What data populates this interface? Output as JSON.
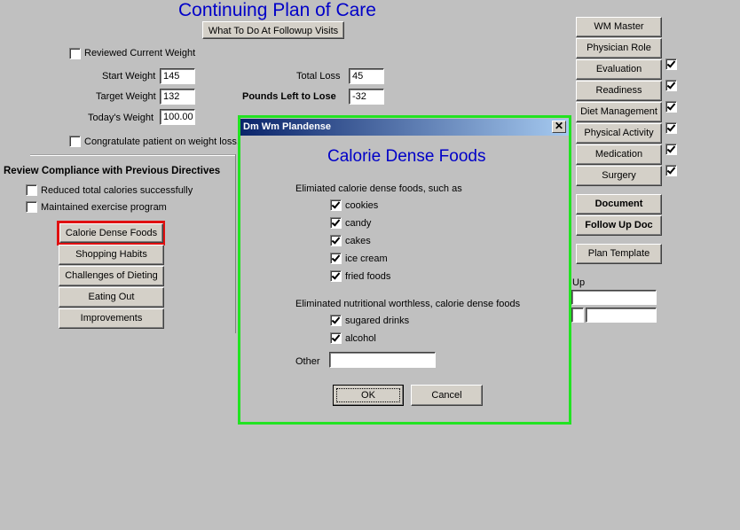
{
  "page": {
    "title": "Continuing Plan of Care",
    "followup_button": "What To Do At Followup Visits",
    "reviewed_weight": {
      "label": "Reviewed Current Weight",
      "checked": false
    },
    "weights": {
      "start_label": "Start Weight",
      "start_value": "145",
      "target_label": "Target Weight",
      "target_value": "132",
      "today_label": "Today's Weight",
      "today_value": "100.00",
      "total_loss_label": "Total Loss",
      "total_loss_value": "45",
      "pounds_left_label": "Pounds Left to Lose",
      "pounds_left_value": "-32"
    },
    "congratulate": {
      "label": "Congratulate patient on weight loss,",
      "checked": false
    },
    "compliance": {
      "heading": "Review Compliance with Previous Directives",
      "items": [
        {
          "label": "Reduced total calories successfully",
          "checked": false
        },
        {
          "label": "Maintained exercise program",
          "checked": false
        }
      ],
      "buttons": [
        "Calorie Dense Foods",
        "Shopping Habits",
        "Challenges of Dieting",
        "Eating Out",
        "Improvements"
      ]
    },
    "right_nav": [
      {
        "label": "WM Master",
        "checked": null
      },
      {
        "label": "Physician Role",
        "checked": null
      },
      {
        "label": "Evaluation",
        "checked": true
      },
      {
        "label": "Readiness",
        "checked": true
      },
      {
        "label": "Diet Management",
        "checked": true
      },
      {
        "label": "Physical Activity",
        "checked": true
      },
      {
        "label": "Medication",
        "checked": true
      },
      {
        "label": "Surgery",
        "checked": true
      }
    ],
    "document_button": "Document",
    "followup_doc_button": "Follow Up Doc",
    "plan_template_button": "Plan Template",
    "partial_label": "Up"
  },
  "dialog": {
    "window_title": "Dm Wm Plandense",
    "heading": "Calorie Dense Foods",
    "section1_label": "Elimiated calorie dense foods, such as",
    "section1_items": [
      {
        "label": "cookies",
        "checked": true
      },
      {
        "label": "candy",
        "checked": true
      },
      {
        "label": "cakes",
        "checked": true
      },
      {
        "label": "ice cream",
        "checked": true
      },
      {
        "label": "fried foods",
        "checked": true
      }
    ],
    "section2_label": "Eliminated nutritional worthless, calorie dense foods",
    "section2_items": [
      {
        "label": "sugared drinks",
        "checked": true
      },
      {
        "label": "alcohol",
        "checked": true
      }
    ],
    "other_label": "Other",
    "other_value": "",
    "ok_label": "OK",
    "cancel_label": "Cancel",
    "close_glyph": "✕"
  },
  "colors": {
    "title_blue": "#0000c8",
    "highlight_red": "#e01010",
    "dialog_border_green": "#22e322"
  }
}
